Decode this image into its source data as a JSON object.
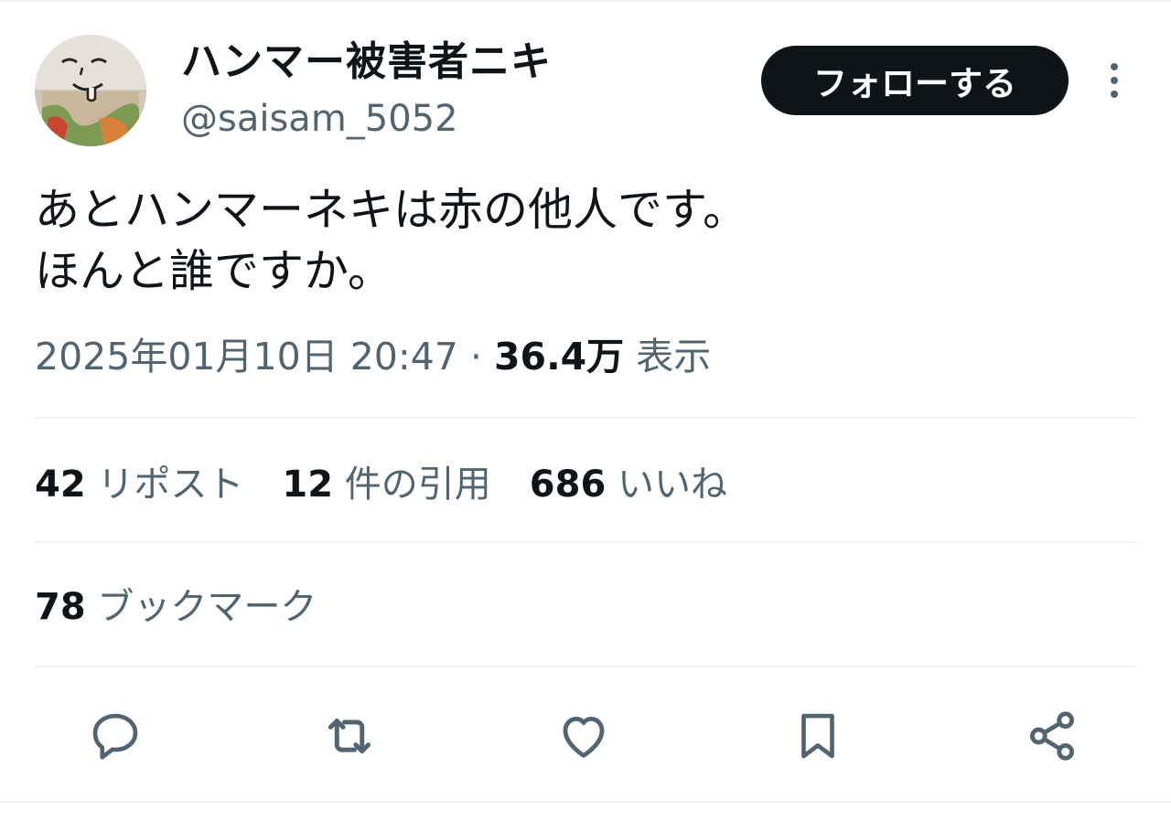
{
  "author": {
    "display_name": "ハンマー被害者ニキ",
    "handle": "@saisam_5052",
    "avatar_icon": "avatar-image"
  },
  "follow_label": "フォローする",
  "more_icon": "more-vertical-icon",
  "tweet": {
    "lines": [
      "あとハンマーネキは赤の他人です。",
      "ほんと誰ですか。"
    ]
  },
  "meta": {
    "datetime": "2025年01月10日 20:47",
    "separator": "·",
    "views_count": "36.4万",
    "views_label": "表示"
  },
  "stats": {
    "reposts_count": "42",
    "reposts_label": "リポスト",
    "quotes_count": "12",
    "quotes_label": "件の引用",
    "likes_count": "686",
    "likes_label": "いいね",
    "bookmarks_count": "78",
    "bookmarks_label": "ブックマーク"
  },
  "actions": {
    "icons": [
      "reply-icon",
      "retweet-icon",
      "like-icon",
      "bookmark-icon",
      "share-icon"
    ],
    "icon_color": "#536471"
  },
  "colors": {
    "text_primary": "#0f1419",
    "text_secondary": "#536471",
    "divider": "#eff3f4",
    "button_bg": "#0f1419"
  }
}
